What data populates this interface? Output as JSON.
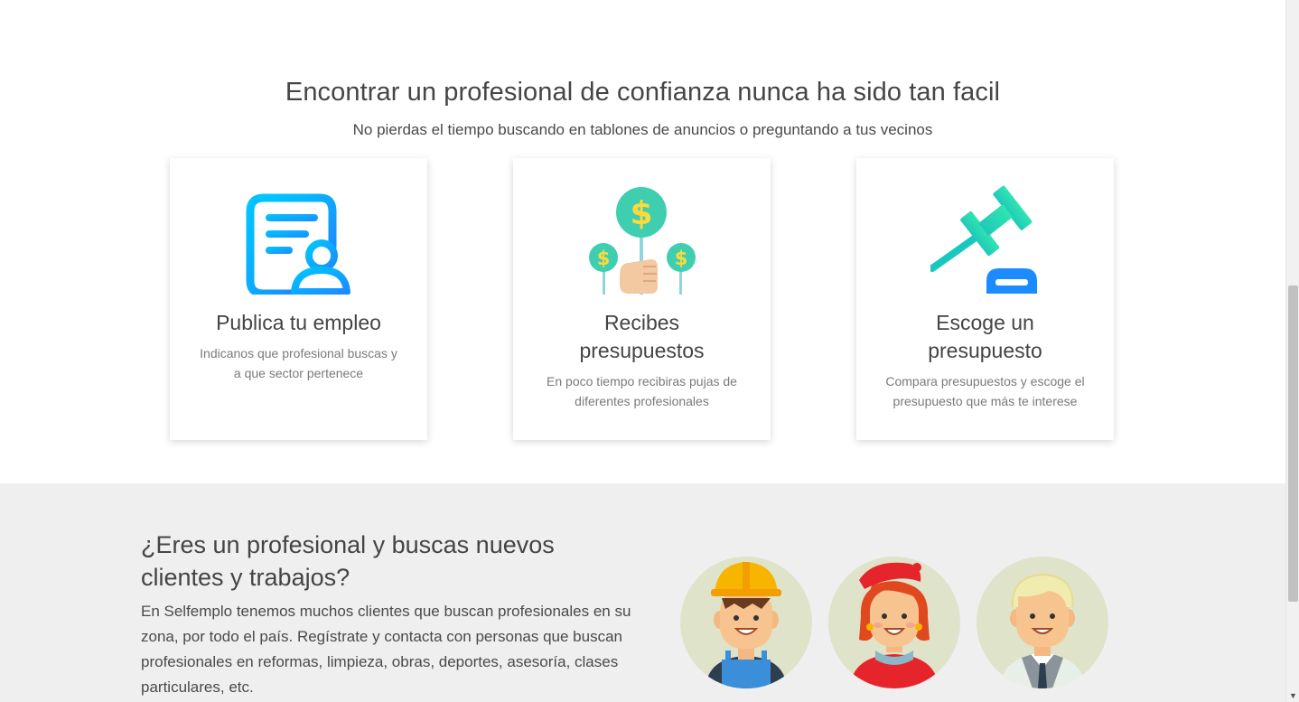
{
  "how_section": {
    "title": "Encontrar un profesional de confianza nunca ha sido tan facil",
    "subtitle": "No pierdas el tiempo buscando en tablones de anuncios o preguntando a tus vecinos",
    "cards": [
      {
        "icon": "document-user-icon",
        "title": "Publica tu empleo",
        "description": "Indicanos que profesional buscas y a que sector pertenece"
      },
      {
        "icon": "money-hand-icon",
        "title": "Recibes presupuestos",
        "description": "En poco tiempo recibiras pujas de diferentes profesionales"
      },
      {
        "icon": "gavel-icon",
        "title": "Escoge un presupuesto",
        "description": "Compara presupuestos y escoge el presupuesto que más te interese"
      }
    ]
  },
  "pros_section": {
    "title": "¿Eres un profesional y buscas nuevos clientes y trabajos?",
    "text": "En Selfemplo tenemos muchos clientes que buscan profesionales en su zona, por todo el país. Regístrate y contacta con personas que buscan profesionales en reformas, limpieza, obras, deportes, asesoría, clases particulares, etc.",
    "avatars": [
      "construction-worker-avatar",
      "painter-woman-avatar",
      "businessman-avatar"
    ]
  },
  "colors": {
    "icon_gradient_start": "#00c6ff",
    "icon_gradient_end": "#1a8cff",
    "coin": "#3fcfb0",
    "gavel": "#18c8c0",
    "section_bg": "#efefef",
    "avatar_bg": "#dfe3c9"
  }
}
